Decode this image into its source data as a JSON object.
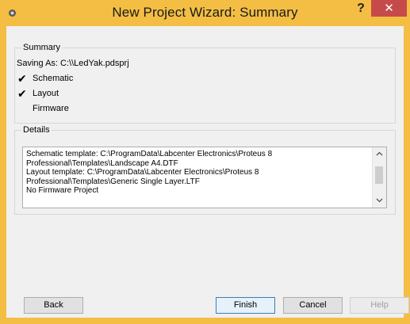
{
  "window": {
    "title": "New Project Wizard: Summary",
    "help_glyph": "?",
    "close_glyph": "✕"
  },
  "summary": {
    "group_title": "Summary",
    "saving_as": "Saving As:  C:\\\\LedYak.pdsprj",
    "items": [
      {
        "label": "Schematic",
        "checked": true
      },
      {
        "label": "Layout",
        "checked": true
      },
      {
        "label": "Firmware",
        "checked": false
      }
    ]
  },
  "details": {
    "group_title": "Details",
    "lines": [
      "Schematic template: C:\\ProgramData\\Labcenter Electronics\\Proteus 8",
      "Professional\\Templates\\Landscape A4.DTF",
      "Layout template: C:\\ProgramData\\Labcenter Electronics\\Proteus 8",
      "Professional\\Templates\\Generic Single Layer.LTF",
      "No Firmware Project"
    ]
  },
  "buttons": {
    "back": "Back",
    "finish": "Finish",
    "cancel": "Cancel",
    "help": "Help"
  },
  "colors": {
    "titlebar": "#f4be44",
    "close": "#c74a4a",
    "client": "#f0f0f0"
  }
}
